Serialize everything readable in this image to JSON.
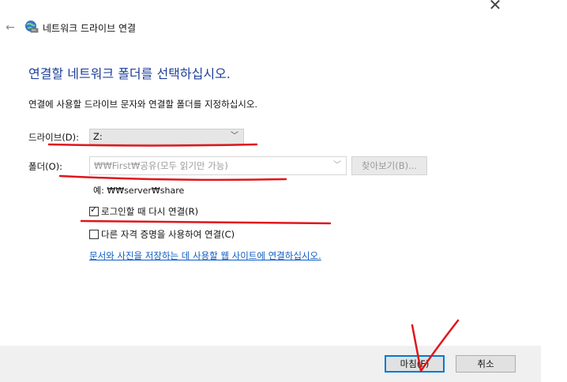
{
  "window": {
    "close_glyph": "✕",
    "back_glyph": "←",
    "title": "네트워크 드라이브 연결",
    "title_icon": "network-drive-icon"
  },
  "main": {
    "heading": "연결할 네트워크 폴더를 선택하십시오.",
    "instruction": "연결에 사용할 드라이브 문자와 연결할 폴더를 지정하십시오.",
    "drive_label": "드라이브(D):",
    "drive_value": "Z:",
    "folder_label": "폴더(O):",
    "folder_value": "₩₩First₩공유(모두 읽기만 가능)",
    "browse_label": "찾아보기(B)...",
    "example_text": "예: ₩₩server₩share",
    "reconnect_label": "로그인할 때 다시 연결(R)",
    "reconnect_checked": true,
    "other_creds_label": "다른 자격 증명을 사용하여 연결(C)",
    "other_creds_checked": false,
    "link_text": "문서와 사진을 저장하는 데 사용할 웹 사이트에 연결하십시오."
  },
  "footer": {
    "finish_label": "마침(F)",
    "cancel_label": "취소"
  },
  "colors": {
    "heading": "#1d3f9a",
    "link": "#0b5bc4",
    "annotation": "#e0161b",
    "default_button_border": "#0078d7"
  }
}
